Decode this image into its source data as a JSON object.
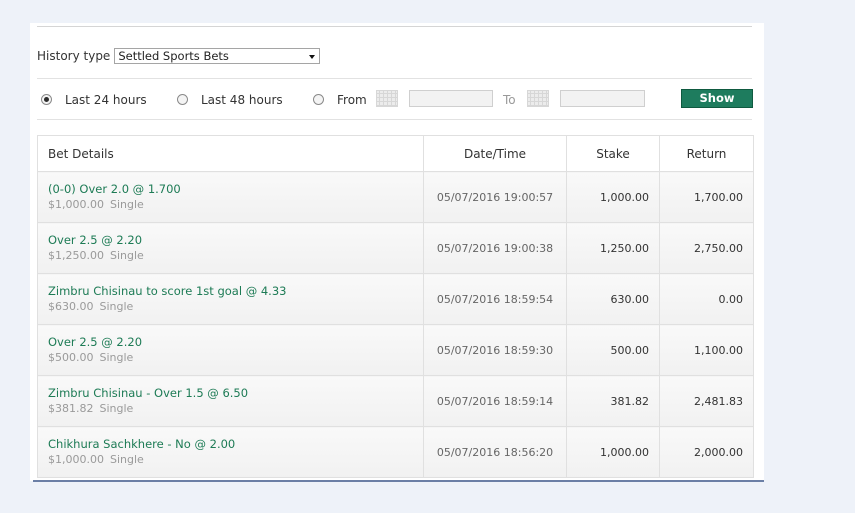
{
  "filters": {
    "history_type_label": "History type",
    "history_type_value": "Settled Sports Bets",
    "option_24h": "Last 24 hours",
    "option_48h": "Last 48 hours",
    "option_from": "From",
    "to_label": "To",
    "show_label": "Show",
    "selected": "24h"
  },
  "table": {
    "headers": {
      "details": "Bet Details",
      "datetime": "Date/Time",
      "stake": "Stake",
      "return": "Return"
    },
    "rows": [
      {
        "description": "(0-0) Over  2.0 @  1.700",
        "amount": "$1,000.00",
        "type": "Single",
        "datetime": "05/07/2016 19:00:57",
        "stake": "1,000.00",
        "return": "1,700.00"
      },
      {
        "description": "Over  2.5 @  2.20",
        "amount": "$1,250.00",
        "type": "Single",
        "datetime": "05/07/2016 19:00:38",
        "stake": "1,250.00",
        "return": "2,750.00"
      },
      {
        "description": "Zimbru Chisinau to score 1st goal @  4.33",
        "amount": "$630.00",
        "type": "Single",
        "datetime": "05/07/2016 18:59:54",
        "stake": "630.00",
        "return": "0.00"
      },
      {
        "description": "Over  2.5 @  2.20",
        "amount": "$500.00",
        "type": "Single",
        "datetime": "05/07/2016 18:59:30",
        "stake": "500.00",
        "return": "1,100.00"
      },
      {
        "description": "Zimbru Chisinau - Over 1.5 @  6.50",
        "amount": "$381.82",
        "type": "Single",
        "datetime": "05/07/2016 18:59:14",
        "stake": "381.82",
        "return": "2,481.83"
      },
      {
        "description": "Chikhura Sachkhere - No @  2.00",
        "amount": "$1,000.00",
        "type": "Single",
        "datetime": "05/07/2016 18:56:20",
        "stake": "1,000.00",
        "return": "2,000.00"
      }
    ]
  },
  "colors": {
    "accent": "#1e7c5e",
    "bet_text": "#1d7b55",
    "background": "#eef2f9"
  }
}
